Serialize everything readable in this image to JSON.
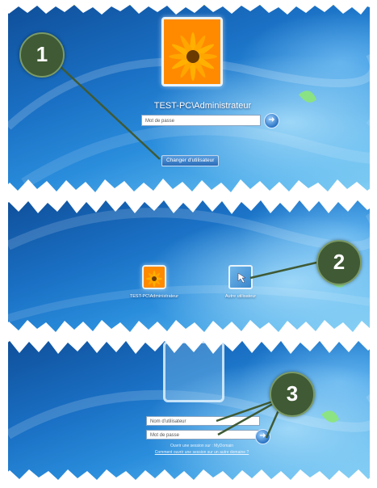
{
  "panel1": {
    "username": "TEST-PC\\Administrateur",
    "password_placeholder": "Mot de passe",
    "switch_user_label": "Changer d'utilisateur",
    "arrow_glyph": "➜"
  },
  "panel2": {
    "admin_label": "TEST-PC\\Administrateur",
    "other_user_label": "Autre utilisateur"
  },
  "panel3": {
    "username_placeholder": "Nom d'utilisateur",
    "password_placeholder": "Mot de passe",
    "logon_line": "Ouvrir une session sur : MyDomain",
    "help_link": "Comment ouvrir une session sur un autre domaine ?",
    "arrow_glyph": "➜"
  },
  "callouts": [
    "1",
    "2",
    "3"
  ],
  "colors": {
    "callout_fill": "#3f5a34",
    "top_bar": "#3d6b1f"
  }
}
